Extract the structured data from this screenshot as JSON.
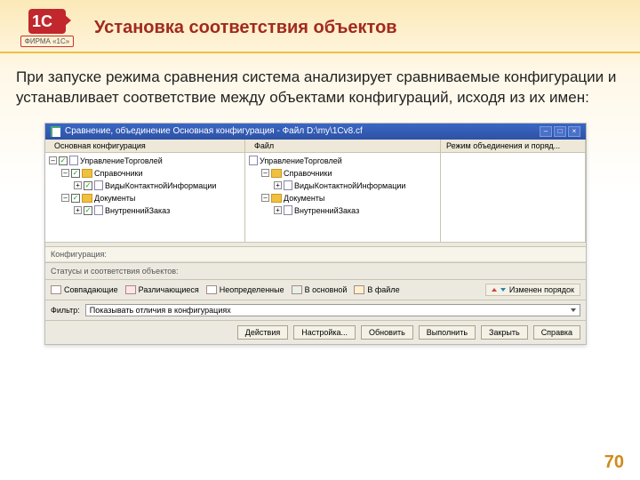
{
  "header": {
    "logo_text": "1С",
    "logo_sub": "ФИРМА «1С»",
    "title": "Установка соответствия объектов"
  },
  "body": "При запуске режима сравнения система анализирует сравниваемые конфигурации и устанавливает соответствие между объектами конфигураций, исходя из их имен:",
  "dialog": {
    "title": "Сравнение, объединение Основная конфигурация - Файл D:\\my\\1Cv8.cf",
    "toolbar": {
      "left_label": "Основная конфигурация",
      "right_label": "Файл"
    },
    "columns": {
      "a": "",
      "b": "",
      "c": "Режим объединения и поряд..."
    },
    "tree_left": [
      "УправлениеТорговлей",
      "Справочники",
      "ВидыКонтактнойИнформации",
      "Документы",
      "ВнутреннийЗаказ"
    ],
    "tree_right": [
      "УправлениеТорговлей",
      "Справочники",
      "ВидыКонтактнойИнформации",
      "Документы",
      "ВнутреннийЗаказ"
    ],
    "cfg_section": "Конфигурация:",
    "status_label": "Статусы и соответствия объектов:",
    "statuses": [
      "Совпадающие",
      "Различающиеся",
      "Неопределенные",
      "В основной",
      "В файле"
    ],
    "change_order": "Изменен порядок",
    "filter_label": "Фильтр:",
    "filter_value": "Показывать отличия в конфигурациях",
    "buttons": [
      "Действия",
      "Настройка...",
      "Обновить",
      "Выполнить",
      "Закрыть",
      "Справка"
    ]
  },
  "colors": {
    "sw0": "#ffffff",
    "sw1": "#ffe6e6",
    "sw2": "#ffffff",
    "sw3": "#e6f0e6",
    "sw4": "#fff0cc"
  },
  "page_number": "70"
}
